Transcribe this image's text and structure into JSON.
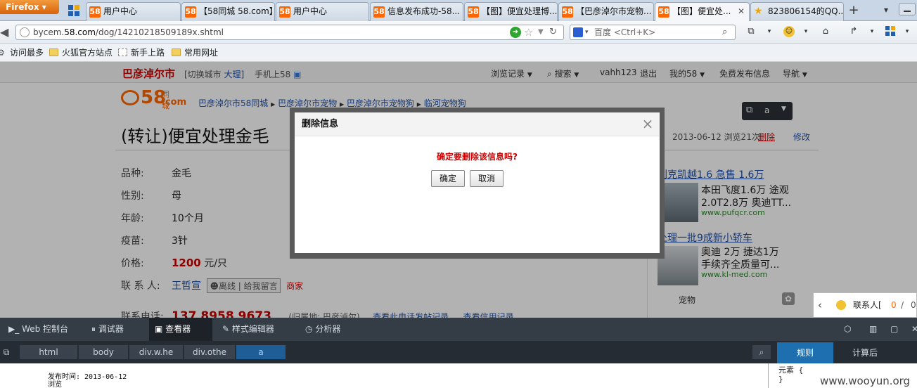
{
  "browser": {
    "app_button": "Firefox",
    "tabs": [
      {
        "label": "用户中心",
        "favicon": "58"
      },
      {
        "label": "【58同城 58.com】...",
        "favicon": "58"
      },
      {
        "label": "用户中心",
        "favicon": "58"
      },
      {
        "label": "信息发布成功-58...",
        "favicon": "58"
      },
      {
        "label": "【图】便宜处理博...",
        "favicon": "58"
      },
      {
        "label": "【巴彦淖尔市宠物...",
        "favicon": "58"
      },
      {
        "label": "【图】便宜处...",
        "favicon": "58"
      },
      {
        "label": "823806154的QQ...",
        "favicon": "star-icon"
      }
    ],
    "new_tab": "+",
    "url_prefix": "bycem.",
    "url_domain": "58.com",
    "url_path": "/dog/14210218509189x.shtml",
    "search_placeholder": "百度 <Ctrl+K>",
    "bookmarks": [
      "访问最多",
      "火狐官方站点",
      "新手上路",
      "常用网址"
    ]
  },
  "site": {
    "city": "巴彦淖尔市",
    "switch_city": "[切换城市",
    "switch_city_target": "大理]",
    "mobile": "手机上58",
    "menu": [
      "浏览记录",
      "搜索",
      "vahh123",
      "退出",
      "我的58",
      "免费发布信息",
      "导航"
    ],
    "logo_text": "58",
    "logo_suffix": "同城",
    "logo_com": ".com",
    "breadcrumb": [
      "巴彦淖尔市58同城",
      "巴彦淖尔市宠物",
      "巴彦淖尔市宠物狗",
      "临河宠物狗"
    ],
    "title": "(转让)便宜处理金毛",
    "post_meta": "2013-06-12 浏览21次",
    "delete_link": "删除",
    "edit_link": "修改",
    "fields": [
      {
        "label": "品种:",
        "value": "金毛"
      },
      {
        "label": "性别:",
        "value": "母"
      },
      {
        "label": "年龄:",
        "value": "10个月"
      },
      {
        "label": "疫苗:",
        "value": "3针"
      }
    ],
    "price_label": "价格:",
    "price_value": "1200",
    "price_unit": "元/只",
    "contact_label": "联 系 人:",
    "contact_name": "王哲宣",
    "offline": "离线",
    "leave_msg": "给我留言",
    "merchant": "商家",
    "phone_label": "联系电话:",
    "phone": "137 8958 9673",
    "phone_note": "(归属地: 巴彦淖尔)",
    "phone_link1": "查看此电话发帖记录",
    "phone_link2": "查看信用记录",
    "ads": [
      {
        "title": "别克凯越1.6 急售 1.6万",
        "desc1": "本田飞度1.6万 途观",
        "desc2": "2.0T2.8万 奥迪TT...",
        "url": "www.pufqcr.com"
      },
      {
        "title": "处理一批9成新小轿车",
        "desc1": "奥迪 2万 捷达1万",
        "desc2": "手续齐全质量可...",
        "url": "www.kl-med.com"
      }
    ],
    "ad_footer": "宠物",
    "chat_label": "联系人[",
    "chat_count": "0",
    "chat_sep": "/",
    "chat_total": "0",
    "float_tool_label": "a"
  },
  "dialog": {
    "title": "删除信息",
    "message": "确定要删除该信息吗?",
    "confirm": "确定",
    "cancel": "取消",
    "close": "×"
  },
  "devtools": {
    "tabs": [
      "Web 控制台",
      "调试器",
      "查看器",
      "样式编辑器",
      "分析器"
    ],
    "breadcrumbs": [
      "html",
      "body",
      "div.w.he",
      "div.othe",
      "a"
    ],
    "panel_tabs": [
      "规则",
      "计算后"
    ],
    "source_line1": "发布时间: 2013-06-12",
    "source_line2": "浏览",
    "rules_line1": "元素 {",
    "rules_line2": "}"
  },
  "watermark": "www.wooyun.org"
}
